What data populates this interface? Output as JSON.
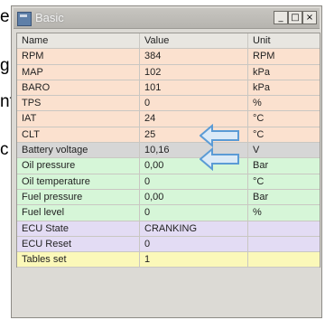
{
  "background_fragments": [
    "e",
    "g.",
    "nt",
    "c"
  ],
  "window": {
    "title": "Basic",
    "buttons": {
      "minimize": "_",
      "maximize": "□",
      "close": "×"
    }
  },
  "table": {
    "headers": [
      "Name",
      "Value",
      "Unit"
    ],
    "rows": [
      {
        "name": "RPM",
        "value": "384",
        "unit": "RPM",
        "group": "engine"
      },
      {
        "name": "MAP",
        "value": "102",
        "unit": "kPa",
        "group": "engine"
      },
      {
        "name": "BARO",
        "value": "101",
        "unit": "kPa",
        "group": "engine"
      },
      {
        "name": "TPS",
        "value": "0",
        "unit": "%",
        "group": "engine"
      },
      {
        "name": "IAT",
        "value": "24",
        "unit": "°C",
        "group": "engine"
      },
      {
        "name": "CLT",
        "value": "25",
        "unit": "°C",
        "group": "engine"
      },
      {
        "name": "Battery voltage",
        "value": "10,16",
        "unit": "V",
        "group": "battery"
      },
      {
        "name": "Oil pressure",
        "value": "0,00",
        "unit": "Bar",
        "group": "fluids"
      },
      {
        "name": "Oil temperature",
        "value": "0",
        "unit": "°C",
        "group": "fluids"
      },
      {
        "name": "Fuel pressure",
        "value": "0,00",
        "unit": "Bar",
        "group": "fluids"
      },
      {
        "name": "Fuel level",
        "value": "0",
        "unit": "%",
        "group": "fluids"
      },
      {
        "name": "ECU State",
        "value": "CRANKING",
        "unit": "",
        "group": "ecu"
      },
      {
        "name": "ECU Reset",
        "value": "0",
        "unit": "",
        "group": "ecu"
      },
      {
        "name": "Tables set",
        "value": "1",
        "unit": "",
        "group": "tables"
      }
    ]
  },
  "group_colors": {
    "engine": "#fbe1cf",
    "battery": "#d6d6d6",
    "fluids": "#d6f6d8",
    "ecu": "#e3dcf4",
    "tables": "#fbf8b9"
  },
  "annotations": {
    "arrow_color": "#5b9bd5",
    "arrow_fill": "#dbeaf7"
  }
}
